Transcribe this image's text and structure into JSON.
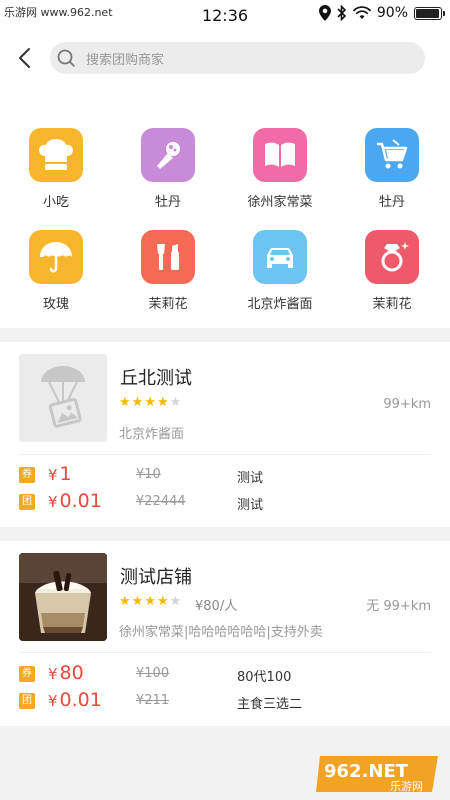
{
  "status": {
    "carrier": "乐游网 www.962.net",
    "time": "12:36",
    "battery_text": "90%",
    "battery_level": 0.9
  },
  "search": {
    "placeholder": "搜索团购商家"
  },
  "categories": [
    {
      "label": "小吃",
      "icon": "chef-hat-icon",
      "color": "#f7b52c"
    },
    {
      "label": "牡丹",
      "icon": "microphone-icon",
      "color": "#c78bd8"
    },
    {
      "label": "徐州家常菜",
      "icon": "book-icon",
      "color": "#f26aa6"
    },
    {
      "label": "牡丹",
      "icon": "shopping-cart-icon",
      "color": "#4aa7f0"
    },
    {
      "label": "玫瑰",
      "icon": "umbrella-icon",
      "color": "#f7b52c"
    },
    {
      "label": "茉莉花",
      "icon": "makeup-icon",
      "color": "#f66a55"
    },
    {
      "label": "北京炸酱面",
      "icon": "car-icon",
      "color": "#6cc4f0"
    },
    {
      "label": "茉莉花",
      "icon": "ring-icon",
      "color": "#ee5a6a"
    }
  ],
  "shops": [
    {
      "name": "丘北测试",
      "rating": 4,
      "per_person": "",
      "distance": "99+km",
      "tags": "北京炸酱面",
      "thumb_icon": "image-placeholder-icon",
      "deals": [
        {
          "badge": "券",
          "currency": "¥",
          "price": "1",
          "original": "¥10",
          "desc": "测试"
        },
        {
          "badge": "团",
          "currency": "¥",
          "price": "0.01",
          "original": "¥22444",
          "desc": "测试"
        }
      ]
    },
    {
      "name": "测试店铺",
      "rating": 4,
      "per_person": "¥80/人",
      "distance": "无 99+km",
      "tags": "徐州家常菜|哈哈哈哈哈哈|支持外卖",
      "thumb_icon": "dessert-photo",
      "deals": [
        {
          "badge": "券",
          "currency": "¥",
          "price": "80",
          "original": "¥100",
          "desc": "80代100"
        },
        {
          "badge": "团",
          "currency": "¥",
          "price": "0.01",
          "original": "¥211",
          "desc": "主食三选二"
        }
      ]
    }
  ],
  "watermark": {
    "text": "962.NET",
    "sub": "乐游网"
  },
  "colors": {
    "price": "#e84a3c",
    "star": "#f5b800",
    "badge": "#f5a623"
  }
}
